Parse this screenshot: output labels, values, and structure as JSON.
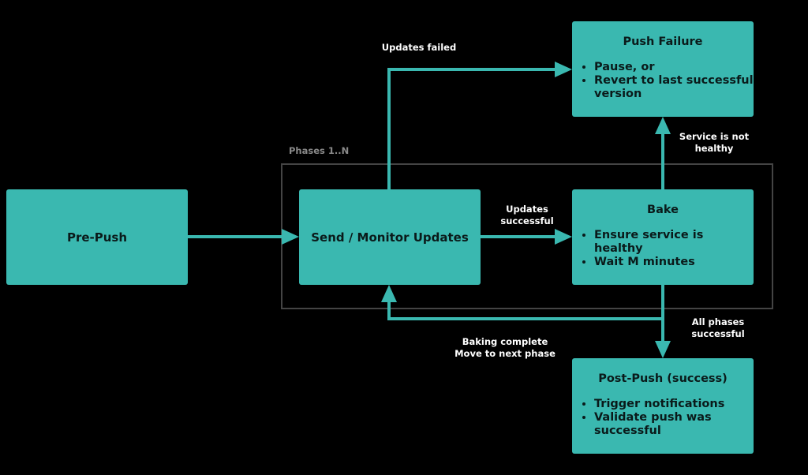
{
  "colors": {
    "box": "#3ab8b0",
    "arrow": "#3ab8b0",
    "phase_border": "#444444",
    "background": "#000000"
  },
  "nodes": {
    "pre_push": {
      "title": "Pre-Push"
    },
    "send_monitor": {
      "title": "Send / Monitor Updates"
    },
    "bake": {
      "title": "Bake",
      "bullets": [
        "Ensure service is healthy",
        "Wait M minutes"
      ]
    },
    "push_failure": {
      "title": "Push Failure",
      "bullets": [
        "Pause, or",
        "Revert to last successful version"
      ]
    },
    "post_push": {
      "title": "Post-Push (success)",
      "bullets": [
        "Trigger notifications",
        "Validate push was successful"
      ]
    }
  },
  "group": {
    "label": "Phases 1..N"
  },
  "edges": {
    "updates_failed": {
      "label": "Updates failed"
    },
    "updates_successful": {
      "line1": "Updates",
      "line2": "successful"
    },
    "service_not_healthy": {
      "line1": "Service is not",
      "line2": "healthy"
    },
    "all_phases_successful": {
      "line1": "All phases",
      "line2": "successful"
    },
    "baking_complete": {
      "line1": "Baking complete",
      "line2": "Move to next phase"
    }
  }
}
